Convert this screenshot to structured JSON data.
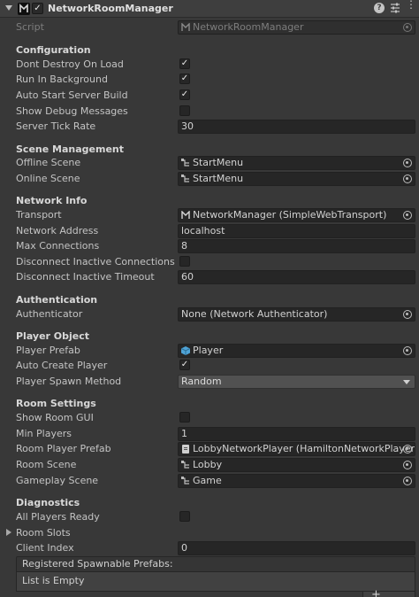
{
  "component": {
    "title": "NetworkRoomManager",
    "enabled_mark": "✓",
    "help": "?",
    "more": "⋮"
  },
  "script": {
    "label": "Script",
    "value": "NetworkRoomManager"
  },
  "configuration": {
    "heading": "Configuration",
    "dont_destroy": {
      "label": "Dont Destroy On Load",
      "checked": true
    },
    "run_in_background": {
      "label": "Run In Background",
      "checked": true
    },
    "auto_start": {
      "label": "Auto Start Server Build",
      "checked": true
    },
    "show_debug": {
      "label": "Show Debug Messages",
      "checked": false
    },
    "server_tick_rate": {
      "label": "Server Tick Rate",
      "value": "30"
    }
  },
  "scene_management": {
    "heading": "Scene Management",
    "offline_scene": {
      "label": "Offline Scene",
      "value": "StartMenu"
    },
    "online_scene": {
      "label": "Online Scene",
      "value": "StartMenu"
    }
  },
  "network_info": {
    "heading": "Network Info",
    "transport": {
      "label": "Transport",
      "value": "NetworkManager (SimpleWebTransport)"
    },
    "network_address": {
      "label": "Network Address",
      "value": "localhost"
    },
    "max_connections": {
      "label": "Max Connections",
      "value": "8"
    },
    "disconnect_inactive": {
      "label": "Disconnect Inactive Connections",
      "checked": false
    },
    "disconnect_timeout": {
      "label": "Disconnect Inactive Timeout",
      "value": "60"
    }
  },
  "authentication": {
    "heading": "Authentication",
    "authenticator": {
      "label": "Authenticator",
      "value": "None (Network Authenticator)"
    }
  },
  "player_object": {
    "heading": "Player Object",
    "player_prefab": {
      "label": "Player Prefab",
      "value": "Player"
    },
    "auto_create": {
      "label": "Auto Create Player",
      "checked": true
    },
    "spawn_method": {
      "label": "Player Spawn Method",
      "value": "Random"
    }
  },
  "room_settings": {
    "heading": "Room Settings",
    "show_room_gui": {
      "label": "Show Room GUI",
      "checked": false
    },
    "min_players": {
      "label": "Min Players",
      "value": "1"
    },
    "room_player_prefab": {
      "label": "Room Player Prefab",
      "value": "LobbyNetworkPlayer (HamiltonNetworkPlayer)"
    },
    "room_scene": {
      "label": "Room Scene",
      "value": "Lobby"
    },
    "gameplay_scene": {
      "label": "Gameplay Scene",
      "value": "Game"
    }
  },
  "diagnostics": {
    "heading": "Diagnostics",
    "all_players_ready": {
      "label": "All Players Ready",
      "checked": false
    },
    "room_slots": {
      "label": "Room Slots"
    },
    "client_index": {
      "label": "Client Index",
      "value": "0"
    }
  },
  "spawnable_prefabs": {
    "header": "Registered Spawnable Prefabs:",
    "empty": "List is Empty",
    "add": "+"
  },
  "colors": {
    "background": "#383838",
    "field_bg": "#262626",
    "text": "#c4c4c4",
    "heading": "#d8d8d8"
  }
}
